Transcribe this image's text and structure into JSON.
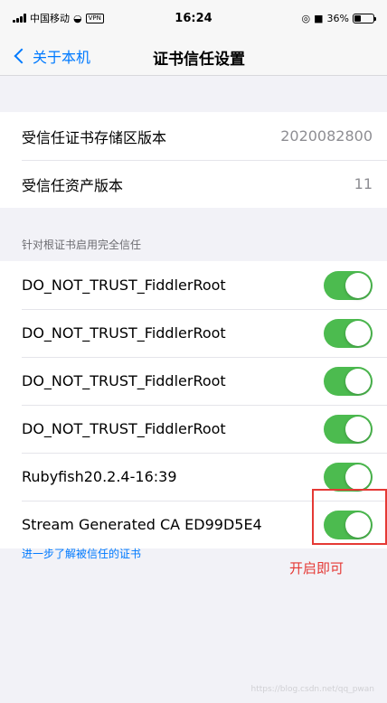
{
  "status_bar": {
    "carrier": "中国移动",
    "vpn": "VPN",
    "time": "16:24",
    "battery": "36%",
    "battery_level": 0.36
  },
  "nav": {
    "back_label": "关于本机",
    "title": "证书信任设置"
  },
  "info_rows": [
    {
      "label": "受信任证书存储区版本",
      "value": "2020082800"
    },
    {
      "label": "受信任资产版本",
      "value": "11"
    }
  ],
  "section_header": "针对根证书启用完全信任",
  "certificates": [
    {
      "name": "DO_NOT_TRUST_FiddlerRoot",
      "enabled": true
    },
    {
      "name": "DO_NOT_TRUST_FiddlerRoot",
      "enabled": true
    },
    {
      "name": "DO_NOT_TRUST_FiddlerRoot",
      "enabled": true
    },
    {
      "name": "DO_NOT_TRUST_FiddlerRoot",
      "enabled": true
    },
    {
      "name": "Rubyfish20.2.4-16:39",
      "enabled": true
    },
    {
      "name": "Stream Generated CA ED99D5E4",
      "enabled": true
    }
  ],
  "footer_link": "进一步了解被信任的证书",
  "annotation": "开启即可",
  "watermark": "https://blog.csdn.net/qq_pwan",
  "colors": {
    "toggle_on": "#4cbb4f",
    "link": "#007aff",
    "annotation": "#e53935"
  }
}
